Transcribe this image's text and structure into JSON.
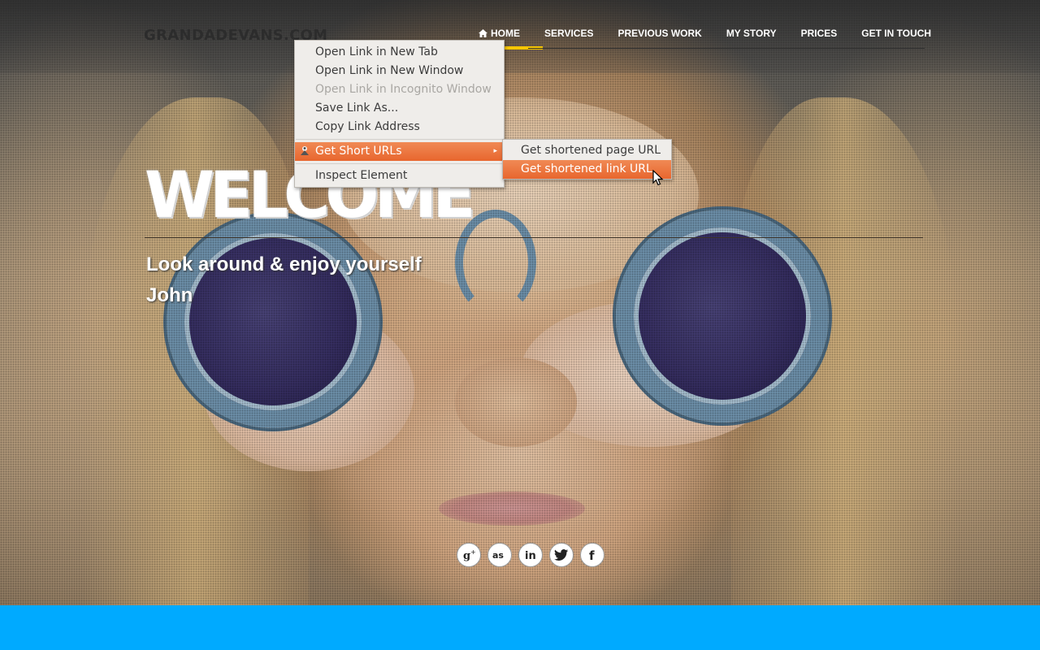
{
  "header": {
    "logo": "GRANDADEVANS.COM",
    "nav": [
      {
        "label": "HOME",
        "active": true
      },
      {
        "label": "SERVICES"
      },
      {
        "label": "PREVIOUS WORK"
      },
      {
        "label": "MY STORY"
      },
      {
        "label": "PRICES"
      },
      {
        "label": "GET IN TOUCH"
      }
    ],
    "accent_color": "#f7c600"
  },
  "hero": {
    "title": "WELCOME",
    "subtitle": "Look around & enjoy yourself",
    "author": "John"
  },
  "social": [
    {
      "icon": "google-plus-icon",
      "glyph": "g+"
    },
    {
      "icon": "lastfm-icon",
      "glyph": "as"
    },
    {
      "icon": "linkedin-icon",
      "glyph": "in"
    },
    {
      "icon": "twitter-icon",
      "glyph": "🐦"
    },
    {
      "icon": "facebook-icon",
      "glyph": "f"
    }
  ],
  "context_menu": {
    "items": [
      {
        "label": "Open Link in New Tab"
      },
      {
        "label": "Open Link in New Window"
      },
      {
        "label": "Open Link in Incognito Window",
        "disabled": true
      },
      {
        "label": "Save Link As..."
      },
      {
        "label": "Copy Link Address"
      },
      {
        "label": "Get Short URLs",
        "highlight": true,
        "has_submenu": true
      },
      {
        "label": "Inspect Element"
      }
    ],
    "submenu": [
      {
        "label": "Get shortened page URL"
      },
      {
        "label": "Get shortened link URL",
        "highlight": true
      }
    ],
    "highlight_color": "#e8662e"
  },
  "footer": {
    "bar_color": "#00aaff"
  }
}
